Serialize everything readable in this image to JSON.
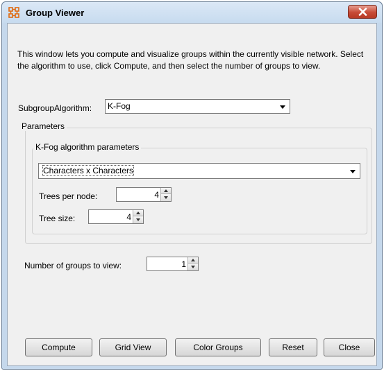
{
  "window": {
    "title": "Group Viewer"
  },
  "description": "This window lets you compute and visualize groups within the currently visible network. Select the algorithm to use, click Compute, and then select the number of groups to view.",
  "subgroup_algorithm": {
    "label": "SubgroupAlgorithm:",
    "value": "K-Fog"
  },
  "parameters": {
    "title": "Parameters",
    "kfog": {
      "title": "K-Fog algorithm parameters",
      "network_select": "Characters x Characters",
      "trees_per_node": {
        "label": "Trees per node:",
        "value": "4"
      },
      "tree_size": {
        "label": "Tree size:",
        "value": "4"
      }
    }
  },
  "groups_to_view": {
    "label": "Number of groups to view:",
    "value": "1"
  },
  "buttons": {
    "compute": "Compute",
    "grid_view": "Grid View",
    "color_groups": "Color Groups",
    "reset": "Reset",
    "close": "Close"
  },
  "icons": {
    "app": "group-viewer-icon",
    "close": "close-icon"
  },
  "colors": {
    "app_icon": "#e06a10",
    "close_button": "#c74b36"
  }
}
